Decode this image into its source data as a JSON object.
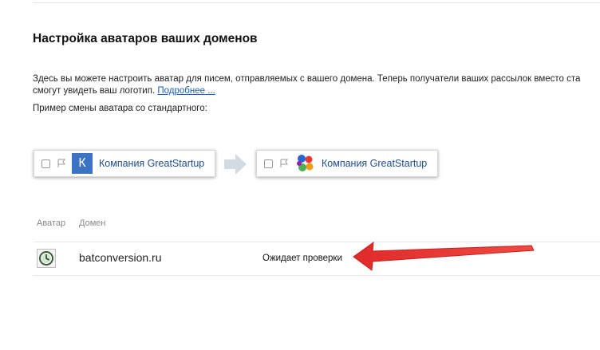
{
  "page": {
    "title": "Настройка аватаров ваших доменов",
    "description_line1": "Здесь вы можете настроить аватар для писем, отправляемых с вашего домена. Теперь получатели ваших рассылок вместо ста",
    "description_line2": "смогут увидеть ваш логотип.",
    "more_link": "Подробнее ...",
    "example_label": "Пример смены аватара со стандартного:"
  },
  "preview": {
    "before": {
      "avatar_letter": "К",
      "sender": "Компания GreatStartup"
    },
    "after": {
      "sender": "Компания GreatStartup"
    }
  },
  "table": {
    "columns": [
      "Аватар",
      "Домен"
    ],
    "rows": [
      {
        "domain": "batconversion.ru",
        "status": "Ожидает проверки",
        "icon": "clock-icon"
      }
    ]
  },
  "colors": {
    "accent": "#3d73c4",
    "link": "#1a5fb4",
    "arrow": "#e53935"
  }
}
